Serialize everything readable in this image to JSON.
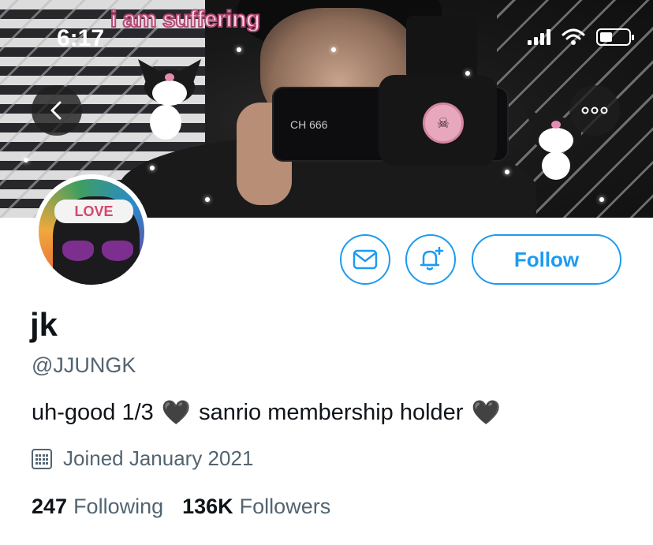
{
  "status_bar": {
    "time": "6:17"
  },
  "banner": {
    "overlay_text": "i am suffering",
    "camera_label": "CH 666"
  },
  "avatar": {
    "band_text": "LOVE"
  },
  "actions": {
    "follow_label": "Follow"
  },
  "profile": {
    "display_name": "jk",
    "handle": "@JJUNGK",
    "bio_part1": "uh-good 1/3",
    "bio_part2": "sanrio membership holder",
    "heart": "🖤",
    "joined": "Joined January 2021"
  },
  "stats": {
    "following_count": "247",
    "following_label": "Following",
    "followers_count": "136K",
    "followers_label": "Followers"
  },
  "colors": {
    "accent": "#1d9bf0",
    "secondary_text": "#536471",
    "primary_text": "#0f1419"
  }
}
